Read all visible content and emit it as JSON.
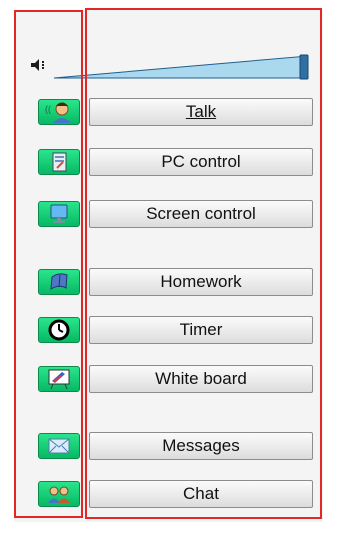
{
  "colors": {
    "highlight": "#e32626",
    "icon_green": "#13cf78",
    "button_face": "#ececec",
    "volume_fill": "#aad8ee",
    "volume_edge": "#1f5f8e"
  },
  "volume": {
    "level": 1.0,
    "speaker_icon": "speaker-icon"
  },
  "buttons": [
    {
      "label": "Talk",
      "icon": "talk-person-icon",
      "underlined": true
    },
    {
      "label": "PC control",
      "icon": "pc-control-icon"
    },
    {
      "label": "Screen control",
      "icon": "monitor-icon"
    },
    {
      "label": "Homework",
      "icon": "homework-icon"
    },
    {
      "label": "Timer",
      "icon": "clock-icon"
    },
    {
      "label": "White board",
      "icon": "whiteboard-icon"
    },
    {
      "label": "Messages",
      "icon": "envelope-icon"
    },
    {
      "label": "Chat",
      "icon": "chat-people-icon"
    }
  ]
}
